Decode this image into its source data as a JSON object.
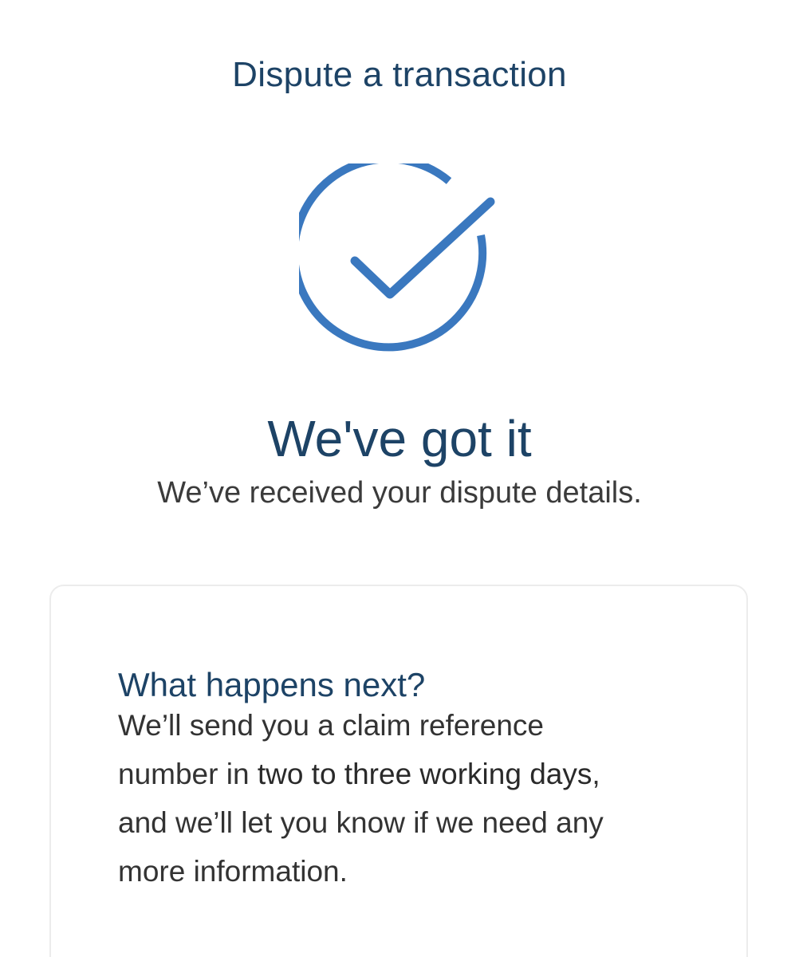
{
  "header": {
    "title": "Dispute a transaction"
  },
  "confirmation": {
    "icon": "check-circle-icon",
    "headline": "We've got it",
    "subline": "We’ve received your dispute details."
  },
  "next_steps": {
    "title": "What happens next?",
    "body_lines": [
      "We’ll send you a claim reference",
      "number in ",
      "two to three working days",
      ",",
      "and we’ll let you know if we need any",
      "more information."
    ]
  },
  "colors": {
    "brand_navy": "#1d4366",
    "accent_blue": "#3a78bf",
    "text_dark": "#333333",
    "card_border": "#ececec"
  }
}
